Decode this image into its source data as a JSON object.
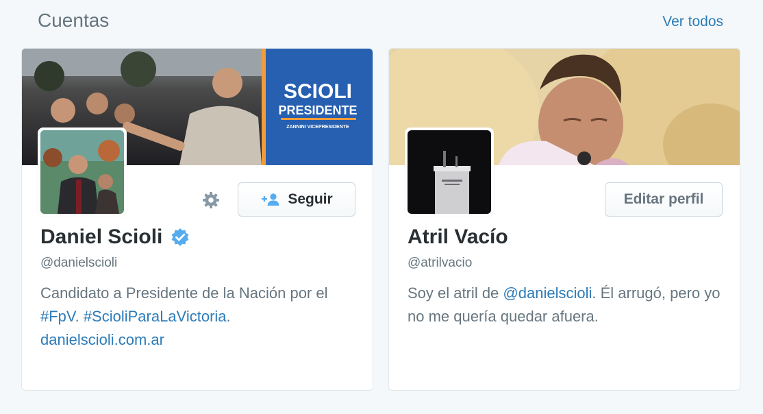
{
  "section": {
    "title": "Cuentas",
    "view_all": "Ver todos"
  },
  "cards": [
    {
      "banner_text": {
        "line1": "SCIOLI",
        "line2": "PRESIDENTE",
        "line3": "ZANNINI VICEPRESIDENTE"
      },
      "action_label": "Seguir",
      "action_icon": "add-user-icon",
      "settings_icon": "gear-icon",
      "name": "Daniel Scioli",
      "verified": true,
      "handle": "@danielscioli",
      "bio": {
        "part1": "Candidato a Presidente de la Nación por el ",
        "tag1": "#FpV",
        "part2": ". ",
        "tag2": "#ScioliParaLaVictoria",
        "part3": ".",
        "url": "danielscioli.com.ar"
      }
    },
    {
      "action_label": "Editar perfil",
      "name": "Atril Vacío",
      "verified": false,
      "handle": "@atrilvacio",
      "bio": {
        "part1": "Soy el atril de ",
        "mention": "@danielscioli",
        "part2": ". Él arrugó, pero yo no me quería quedar afuera."
      }
    }
  ],
  "colors": {
    "link": "#2b7bb9",
    "verified": "#55acee",
    "banner_blue": "#2760b0",
    "banner_orange": "#f39c3a"
  }
}
